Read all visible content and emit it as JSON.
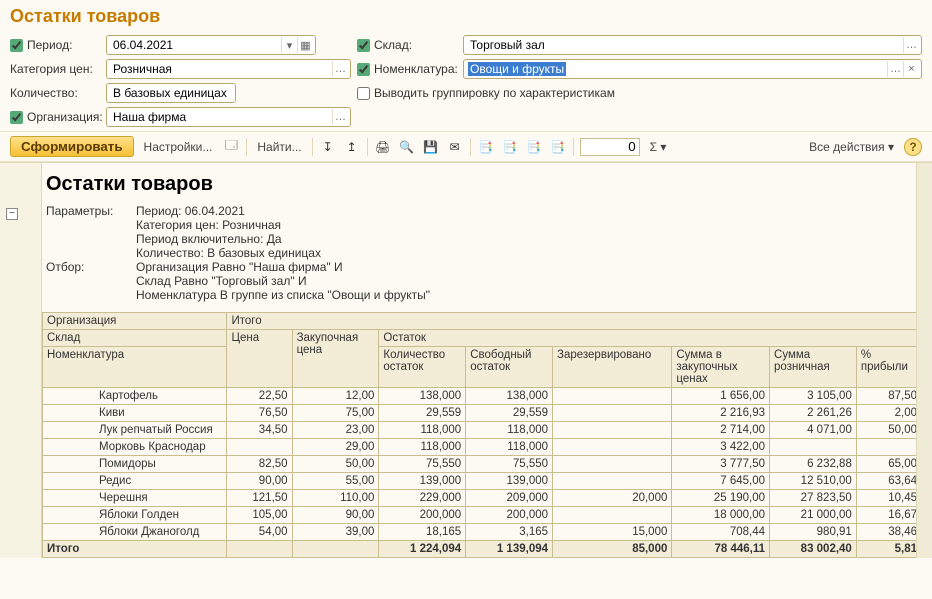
{
  "title": "Остатки товаров",
  "filters": {
    "period_label": "Период:",
    "period_value": "06.04.2021",
    "warehouse_label": "Склад:",
    "warehouse_value": "Торговый зал",
    "price_cat_label": "Категория цен:",
    "price_cat_value": "Розничная",
    "nomen_label": "Номенклатура:",
    "nomen_value": "Овощи и фрукты",
    "qty_label": "Количество:",
    "qty_value": "В базовых единицах",
    "group_label": "Выводить группировку по характеристикам",
    "org_label": "Организация:",
    "org_value": "Наша фирма"
  },
  "toolbar": {
    "form": "Сформировать",
    "settings": "Настройки...",
    "find": "Найти...",
    "counter": "0",
    "sigma": "Σ",
    "all_actions": "Все действия"
  },
  "report": {
    "title": "Остатки товаров",
    "params_label": "Параметры:",
    "params_lines": [
      "Период: 06.04.2021",
      "Категория цен: Розничная",
      "Период включительно: Да",
      "Количество: В базовых единицах"
    ],
    "filter_label": "Отбор:",
    "filter_lines": [
      "Организация Равно \"Наша фирма\" И",
      "Склад Равно \"Торговый зал\" И",
      "Номенклатура В группе из списка \"Овощи и фрукты\""
    ],
    "headers": {
      "org": "Организация",
      "total": "Итого",
      "warehouse": "Склад",
      "price": "Цена",
      "purchase_price": "Закупочная цена",
      "remainder": "Остаток",
      "nomen": "Номенклатура",
      "qty_rem": "Количество остаток",
      "free_rem": "Свободный остаток",
      "reserved": "Зарезервировано",
      "sum_purchase": "Сумма в закупочных ценах",
      "sum_retail": "Сумма розничная",
      "profit_pct": "% прибыли"
    },
    "rows": [
      {
        "name": "Картофель",
        "price": "22,50",
        "pprice": "12,00",
        "qty": "138,000",
        "free": "138,000",
        "res": "",
        "spur": "1 656,00",
        "sret": "3 105,00",
        "pct": "87,50"
      },
      {
        "name": "Киви",
        "price": "76,50",
        "pprice": "75,00",
        "qty": "29,559",
        "free": "29,559",
        "res": "",
        "spur": "2 216,93",
        "sret": "2 261,26",
        "pct": "2,00"
      },
      {
        "name": "Лук репчатый Россия",
        "price": "34,50",
        "pprice": "23,00",
        "qty": "118,000",
        "free": "118,000",
        "res": "",
        "spur": "2 714,00",
        "sret": "4 071,00",
        "pct": "50,00"
      },
      {
        "name": "Морковь Краснодар",
        "price": "",
        "pprice": "29,00",
        "qty": "118,000",
        "free": "118,000",
        "res": "",
        "spur": "3 422,00",
        "sret": "",
        "pct": ""
      },
      {
        "name": "Помидоры",
        "price": "82,50",
        "pprice": "50,00",
        "qty": "75,550",
        "free": "75,550",
        "res": "",
        "spur": "3 777,50",
        "sret": "6 232,88",
        "pct": "65,00"
      },
      {
        "name": "Редис",
        "price": "90,00",
        "pprice": "55,00",
        "qty": "139,000",
        "free": "139,000",
        "res": "",
        "spur": "7 645,00",
        "sret": "12 510,00",
        "pct": "63,64"
      },
      {
        "name": "Черешня",
        "price": "121,50",
        "pprice": "110,00",
        "qty": "229,000",
        "free": "209,000",
        "res": "20,000",
        "spur": "25 190,00",
        "sret": "27 823,50",
        "pct": "10,45"
      },
      {
        "name": "Яблоки Голден",
        "price": "105,00",
        "pprice": "90,00",
        "qty": "200,000",
        "free": "200,000",
        "res": "",
        "spur": "18 000,00",
        "sret": "21 000,00",
        "pct": "16,67"
      },
      {
        "name": "Яблоки Джаноголд",
        "price": "54,00",
        "pprice": "39,00",
        "qty": "18,165",
        "free": "3,165",
        "res": "15,000",
        "spur": "708,44",
        "sret": "980,91",
        "pct": "38,46"
      }
    ],
    "total": {
      "label": "Итого",
      "qty": "1 224,094",
      "free": "1 139,094",
      "res": "85,000",
      "spur": "78 446,11",
      "sret": "83 002,40",
      "pct": "5,81"
    }
  }
}
